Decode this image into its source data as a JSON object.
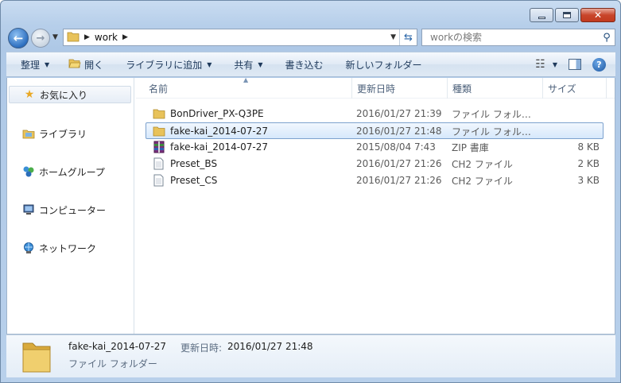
{
  "window": {
    "caption_buttons": [
      "minimize-icon",
      "maximize-icon",
      "close-icon"
    ]
  },
  "address": {
    "crumb": "work"
  },
  "search": {
    "placeholder": "workの検索"
  },
  "toolbar": {
    "organize": "整理",
    "open": "開く",
    "library": "ライブラリに追加",
    "share": "共有",
    "burn": "書き込む",
    "new_folder": "新しいフォルダー"
  },
  "navpane": {
    "favorites": "お気に入り",
    "libraries": "ライブラリ",
    "homegroup": "ホームグループ",
    "computer": "コンピューター",
    "network": "ネットワーク"
  },
  "columns": {
    "name": "名前",
    "date": "更新日時",
    "type": "種類",
    "size": "サイズ"
  },
  "files": [
    {
      "name": "BonDriver_PX-Q3PE",
      "date": "2016/01/27 21:39",
      "type": "ファイル フォル…",
      "size": "",
      "icon": "folder-icon"
    },
    {
      "name": "fake-kai_2014-07-27",
      "date": "2016/01/27 21:48",
      "type": "ファイル フォル…",
      "size": "",
      "icon": "folder-icon",
      "selected": true
    },
    {
      "name": "fake-kai_2014-07-27",
      "date": "2015/08/04 7:43",
      "type": "ZIP 書庫",
      "size": "8 KB",
      "icon": "zip-archive-icon"
    },
    {
      "name": "Preset_BS",
      "date": "2016/01/27 21:26",
      "type": "CH2 ファイル",
      "size": "2 KB",
      "icon": "file-icon"
    },
    {
      "name": "Preset_CS",
      "date": "2016/01/27 21:26",
      "type": "CH2 ファイル",
      "size": "3 KB",
      "icon": "file-icon"
    }
  ],
  "details": {
    "name": "fake-kai_2014-07-27",
    "modified_label": "更新日時:",
    "modified_value": "2016/01/27 21:48",
    "type": "ファイル フォルダー"
  },
  "colors": {
    "folder": "#e8c25a",
    "selection_border": "#7da2ce",
    "toolbar_text": "#1e395b"
  }
}
